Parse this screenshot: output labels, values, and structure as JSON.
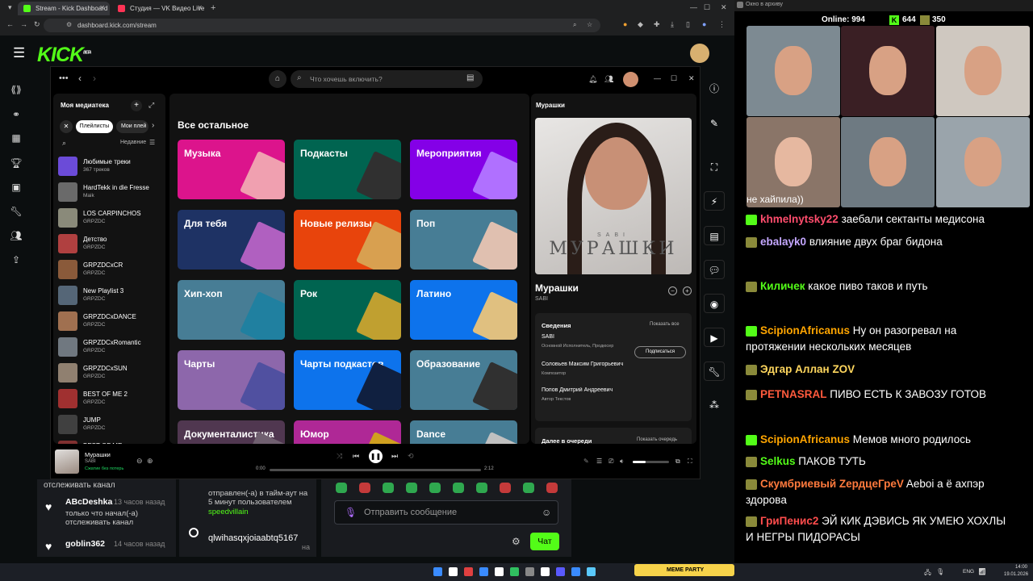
{
  "browser": {
    "tabs": [
      {
        "label": "Stream - Kick Dashboard"
      },
      {
        "label": "Студия — VK Видео Live"
      }
    ],
    "url": "dashboard.kick.com/stream"
  },
  "kick": {
    "logo": "KICK",
    "beta": "BETA"
  },
  "spotify": {
    "search_placeholder": "Что хочешь включить?",
    "library": {
      "title": "Моя медиатека",
      "chips": [
        "Плейлисты",
        "Мои плей"
      ],
      "sort_label": "Недавние",
      "items": [
        {
          "title": "Любимые треки",
          "subtitle": "367 треков",
          "color": "#6b4bd8"
        },
        {
          "title": "HardTekk in die Fresse",
          "subtitle": "Maik",
          "color": "#6a6a6a"
        },
        {
          "title": "LOS CARPINCHOS",
          "subtitle": "GRPZDC",
          "color": "#8a8a7a"
        },
        {
          "title": "Детство",
          "subtitle": "GRPZDC",
          "color": "#b04040"
        },
        {
          "title": "GRPZDCxCR",
          "subtitle": "GRPZDC",
          "color": "#8a5a3a"
        },
        {
          "title": "New Playlist 3",
          "subtitle": "GRPZDC",
          "color": "#556677"
        },
        {
          "title": "GRPZDCxDANCE",
          "subtitle": "GRPZDC",
          "color": "#a07050"
        },
        {
          "title": "GRPZDCxRomantic",
          "subtitle": "GRPZDC",
          "color": "#707880"
        },
        {
          "title": "GRPZDCxSUN",
          "subtitle": "GRPZDC",
          "color": "#908070"
        },
        {
          "title": "BEST OF ME 2",
          "subtitle": "GRPZDC",
          "color": "#a03030"
        },
        {
          "title": "JUMP",
          "subtitle": "GRPZDC",
          "color": "#404040"
        },
        {
          "title": "BEST OF ME",
          "subtitle": "",
          "color": "#803030"
        }
      ]
    },
    "main": {
      "section_title": "Все остальное",
      "categories": [
        {
          "label": "Музыка",
          "color": "#dc148c",
          "art": "#f0a0b0"
        },
        {
          "label": "Подкасты",
          "color": "#006450",
          "art": "#303030"
        },
        {
          "label": "Мероприятия",
          "color": "#8400e7",
          "art": "#b070ff"
        },
        {
          "label": "Для тебя",
          "color": "#1e3264",
          "art": "#b060c0"
        },
        {
          "label": "Новые релизы",
          "color": "#e8440c",
          "art": "#d8a050"
        },
        {
          "label": "Поп",
          "color": "#477d95",
          "art": "#e0c0b0"
        },
        {
          "label": "Хип-хоп",
          "color": "#477d95",
          "art": "#2080a0"
        },
        {
          "label": "Рок",
          "color": "#006450",
          "art": "#c0a030"
        },
        {
          "label": "Латино",
          "color": "#0d73ec",
          "art": "#e0c080"
        },
        {
          "label": "Чарты",
          "color": "#8d67ab",
          "art": "#5050a0"
        },
        {
          "label": "Чарты подкастов",
          "color": "#0d73ec",
          "art": "#102040"
        },
        {
          "label": "Образование",
          "color": "#477d95",
          "art": "#303030"
        },
        {
          "label": "Документалистика",
          "color": "#503750",
          "art": "#706070"
        },
        {
          "label": "Юмор",
          "color": "#af2896",
          "art": "#d0a020"
        },
        {
          "label": "Dance",
          "color": "#477d95",
          "art": "#c0c0c0"
        }
      ]
    },
    "now_playing": {
      "header": "Мурашки",
      "cover_artist": "SABI",
      "cover_title": "МУРАШКИ",
      "title": "Мурашки",
      "artist": "SABI",
      "credits_title": "Сведения",
      "show_all": "Показать все",
      "credits": [
        {
          "name": "SABI",
          "role": "Основной Исполнитель, Продюсер"
        },
        {
          "name": "Соловьев Максим Григорьевич",
          "role": "Композитор"
        },
        {
          "name": "Попов Дмитрий Андреевич",
          "role": "Автор Текстов"
        }
      ],
      "follow": "Подписаться",
      "queue_title": "Далее в очереди",
      "queue_link": "Показать очередь"
    },
    "player": {
      "track": "Мурашки",
      "artist": "SABI",
      "saved": "Сжатие без потерь",
      "elapsed": "0:00",
      "duration": "2:12",
      "progress": 0.0,
      "volume": 0.35
    }
  },
  "kick_chat_left": [
    {
      "user": "",
      "time": "",
      "text": "отслеживать канал"
    },
    {
      "user": "ABcDeshka",
      "time": "13 часов назад",
      "text": "только что начал(-а) отслеживать канал"
    },
    {
      "user": "goblin362",
      "time": "14 часов назад",
      "text": ""
    }
  ],
  "kick_chat_mid": {
    "text": "отправлен(-а) в тайм-аут на 5 минут пользователем",
    "moderator": "speedvillain",
    "user2": "qlwihasqxjoiaabtq5167",
    "ago": "на"
  },
  "kick_chat_input": {
    "placeholder": "Отправить сообщение",
    "send": "Чат"
  },
  "stream_overlay": {
    "window_title": "Окно в архиву",
    "online_label": "Online:",
    "online": "994",
    "kick_count": "644",
    "vk_count": "350",
    "top_fragment": "не хайпила))",
    "messages": [
      {
        "user": "khmelnytsky22",
        "color": "#ff4d6d",
        "platform": "kick",
        "text": "заебали сектанты медисона"
      },
      {
        "user": "ebalayk0",
        "color": "#c4a7ff",
        "platform": "vk",
        "text": "влияние двух браг бидона"
      },
      {
        "user": "Киличек",
        "color": "#53fc18",
        "platform": "vk",
        "text": "какое пиво таков и путь"
      },
      {
        "user": "ScipionAfricanus",
        "color": "#ffa500",
        "platform": "kick",
        "text": "Ну он разогревал на протяжении нескольких месяцев"
      },
      {
        "user": "Эдгар Аллан ZOV",
        "color": "#ffd75e",
        "platform": "vk",
        "text": ""
      },
      {
        "user": "PETNASRAL",
        "color": "#ff5a3d",
        "platform": "vk",
        "text": "ПИВО ЕСТЬ  К ЗАВОЗУ ГОТОВ"
      },
      {
        "user": "ScipionAfricanus",
        "color": "#ffa500",
        "platform": "kick",
        "text": "Мемов много родилось"
      },
      {
        "user": "Selkus",
        "color": "#53fc18",
        "platform": "vk",
        "text": "ПАКОВ ТУТЬ"
      },
      {
        "user": "Скумбриевый ZердцеГреV",
        "color": "#ff7a3d",
        "platform": "vk",
        "text": "Aeboi а ё ахпэр здорова",
        "mention": "Aeboi"
      },
      {
        "user": "ГриПенис2",
        "color": "#ff4d4d",
        "platform": "vk",
        "text": "ЭЙ КИК ДЭВИСЬ ЯК УМЕЮ  ХОХЛЫ И НЕГРЫ ПИДОРАСЫ"
      }
    ]
  },
  "taskbar": {
    "lang": "ENG",
    "time": "14:00",
    "date": "19.01.2026",
    "widget": "MEME PARTY"
  }
}
